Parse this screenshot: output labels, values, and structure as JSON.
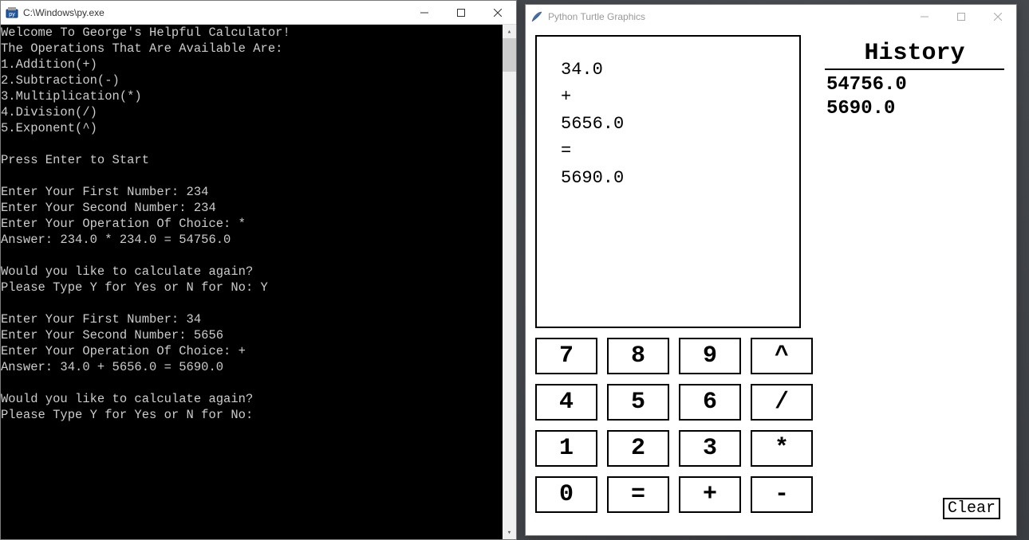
{
  "console": {
    "title": "C:\\Windows\\py.exe",
    "lines": [
      "Welcome To George's Helpful Calculator!",
      "The Operations That Are Available Are:",
      "1.Addition(+)",
      "2.Subtraction(-)",
      "3.Multiplication(*)",
      "4.Division(/)",
      "5.Exponent(^)",
      "",
      "Press Enter to Start",
      "",
      "Enter Your First Number: 234",
      "Enter Your Second Number: 234",
      "Enter Your Operation Of Choice: *",
      "Answer: 234.0 * 234.0 = 54756.0",
      "",
      "Would you like to calculate again?",
      "Please Type Y for Yes or N for No: Y",
      "",
      "Enter Your First Number: 34",
      "Enter Your Second Number: 5656",
      "Enter Your Operation Of Choice: +",
      "Answer: 34.0 + 5656.0 = 5690.0",
      "",
      "Would you like to calculate again?",
      "Please Type Y for Yes or N for No:"
    ]
  },
  "turtle": {
    "title": "Python Turtle Graphics",
    "display_lines": [
      "34.0",
      "+",
      "5656.0",
      "=",
      "5690.0"
    ],
    "keys": [
      "7",
      "8",
      "9",
      "^",
      "4",
      "5",
      "6",
      "/",
      "1",
      "2",
      "3",
      "*",
      "0",
      "=",
      "+",
      "-"
    ],
    "history_title": "History",
    "history_items": [
      "54756.0",
      "5690.0"
    ],
    "clear_label": "Clear"
  }
}
